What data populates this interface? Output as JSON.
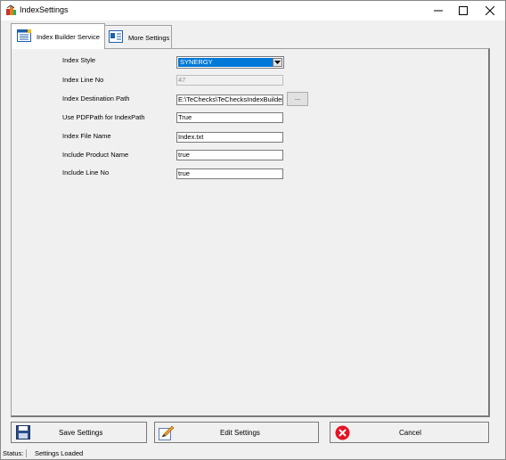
{
  "window": {
    "title": "IndexSettings"
  },
  "tabs": [
    {
      "label": "Index Builder Service",
      "active": true
    },
    {
      "label": "More Settings",
      "active": false
    }
  ],
  "fields": {
    "index_style": {
      "label": "Index Style",
      "value": "SYNERGY"
    },
    "index_line_no": {
      "label": "Index Line No",
      "value": "47"
    },
    "index_destination_path": {
      "label": "Index Destination Path",
      "value": "E:\\TeChecks\\TeChecksIndexBuilder\\"
    },
    "browse_label": "...",
    "use_pdfpath": {
      "label": "Use PDFPath for IndexPath",
      "value": "True"
    },
    "index_file_name": {
      "label": "Index File Name",
      "value": "Index.txt"
    },
    "include_product_name": {
      "label": "Include Product Name",
      "value": "true"
    },
    "include_line_no": {
      "label": "Include Line No",
      "value": "true"
    }
  },
  "buttons": {
    "save": "Save Settings",
    "edit": "Edit Settings",
    "cancel": "Cancel"
  },
  "status": {
    "label": "Status:",
    "text": "Settings Loaded"
  },
  "colors": {
    "accent": "#0078d7",
    "cancel_red": "#e81123"
  }
}
